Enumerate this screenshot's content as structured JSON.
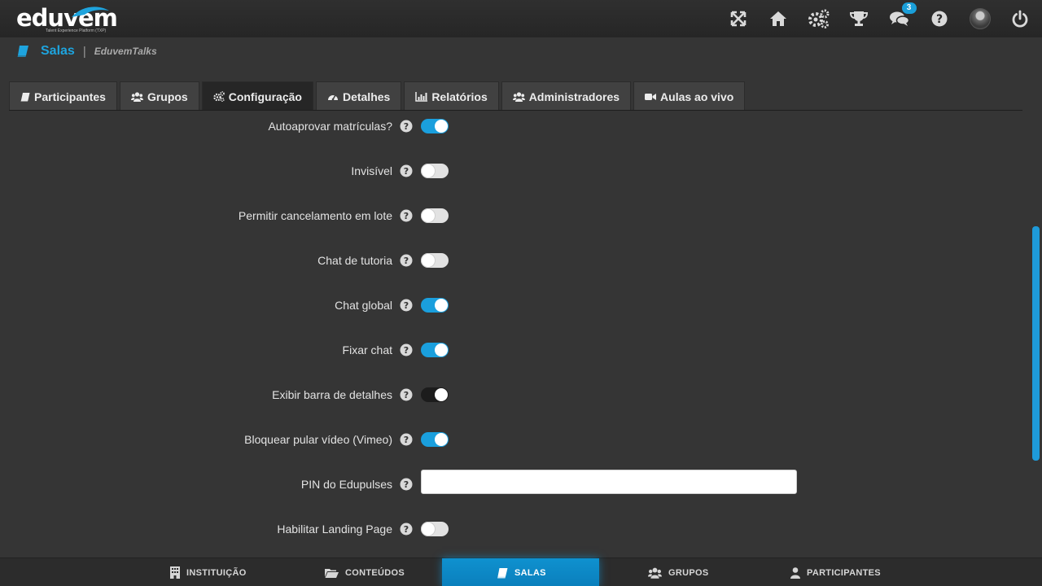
{
  "brand": {
    "name": "eduvem",
    "tagline": "Talent Experience Platform (TXP)"
  },
  "topbar": {
    "icons": [
      {
        "name": "fullscreen-icon"
      },
      {
        "name": "home-icon"
      },
      {
        "name": "gears-icon"
      },
      {
        "name": "trophy-icon"
      },
      {
        "name": "chat-icon",
        "badge": "3"
      },
      {
        "name": "help-icon"
      },
      {
        "name": "avatar"
      },
      {
        "name": "power-icon"
      }
    ]
  },
  "breadcrumb": {
    "section": "Salas",
    "separator": "|",
    "room": "EduvemTalks"
  },
  "tabs": [
    {
      "label": "Participantes",
      "icon": "book-icon"
    },
    {
      "label": "Grupos",
      "icon": "users-icon"
    },
    {
      "label": "Configuração",
      "icon": "gears-icon",
      "active": true
    },
    {
      "label": "Detalhes",
      "icon": "dashboard-icon"
    },
    {
      "label": "Relatórios",
      "icon": "bar-chart-icon"
    },
    {
      "label": "Administradores",
      "icon": "users-icon"
    },
    {
      "label": "Aulas ao vivo",
      "icon": "video-camera-icon"
    }
  ],
  "settings": [
    {
      "label": "Autoaprovar matrículas?",
      "type": "toggle",
      "value": "on"
    },
    {
      "label": "Invisível",
      "type": "toggle",
      "value": "off"
    },
    {
      "label": "Permitir cancelamento em lote",
      "type": "toggle",
      "value": "off"
    },
    {
      "label": "Chat de tutoria",
      "type": "toggle",
      "value": "off"
    },
    {
      "label": "Chat global",
      "type": "toggle",
      "value": "on"
    },
    {
      "label": "Fixar chat",
      "type": "toggle",
      "value": "on"
    },
    {
      "label": "Exibir barra de detalhes",
      "type": "toggle",
      "value": "on"
    },
    {
      "label": "Bloquear pular vídeo (Vimeo)",
      "type": "toggle",
      "value": "on"
    },
    {
      "label": "PIN do Edupulses",
      "type": "text",
      "value": ""
    },
    {
      "label": "Habilitar Landing Page",
      "type": "toggle",
      "value": "off"
    }
  ],
  "bottom_nav": [
    {
      "label": "INSTITUIÇÃO",
      "icon": "building-icon"
    },
    {
      "label": "CONTEÚDOS",
      "icon": "folder-icon"
    },
    {
      "label": "SALAS",
      "icon": "book-icon",
      "active": true
    },
    {
      "label": "GRUPOS",
      "icon": "users-icon"
    },
    {
      "label": "PARTICIPANTES",
      "icon": "user-icon"
    }
  ],
  "colors": {
    "accent": "#1a9fdd",
    "background": "#353535",
    "topbar": "#262626",
    "toggle_off": "#e2e2e2"
  }
}
